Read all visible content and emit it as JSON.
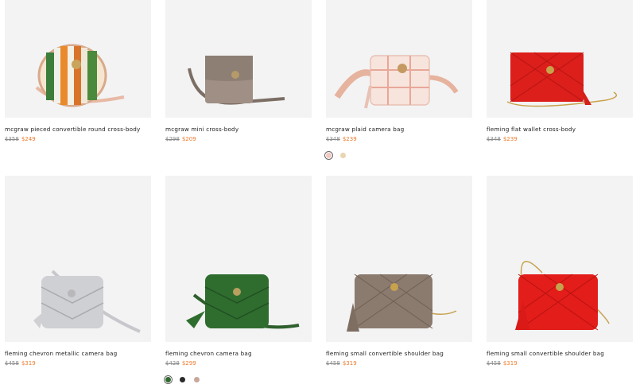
{
  "products": [
    {
      "name": "mcgraw pieced convertible round cross-body",
      "old_price": "$358",
      "sale_price": "$249",
      "image_icon": "round-striped-crossbody-bag-icon"
    },
    {
      "name": "mcgraw mini cross-body",
      "old_price": "$298",
      "sale_price": "$209",
      "image_icon": "taupe-mini-crossbody-bag-icon"
    },
    {
      "name": "mcgraw plaid camera bag",
      "old_price": "$348",
      "sale_price": "$239",
      "image_icon": "plaid-camera-bag-icon",
      "swatches": [
        {
          "color": "#f2c8c0",
          "selected": true
        },
        {
          "color": "#e9d5b0",
          "selected": false
        }
      ]
    },
    {
      "name": "fleming flat wallet cross-body",
      "old_price": "$348",
      "sale_price": "$239",
      "image_icon": "red-quilted-wallet-crossbody-icon"
    },
    {
      "name": "fleming chevron metallic camera bag",
      "old_price": "$458",
      "sale_price": "$319",
      "image_icon": "silver-chevron-camera-bag-icon"
    },
    {
      "name": "fleming chevron camera bag",
      "old_price": "$428",
      "sale_price": "$299",
      "image_icon": "green-chevron-camera-bag-icon",
      "swatches": [
        {
          "color": "#2f6b2e",
          "selected": true
        },
        {
          "color": "#2a2a2a",
          "selected": false
        },
        {
          "color": "#c8a898",
          "selected": false
        }
      ]
    },
    {
      "name": "fleming small convertible shoulder bag",
      "old_price": "$458",
      "sale_price": "$319",
      "image_icon": "taupe-quilted-shoulder-bag-icon"
    },
    {
      "name": "fleming small convertible shoulder bag",
      "old_price": "$458",
      "sale_price": "$319",
      "image_icon": "red-quilted-shoulder-bag-icon"
    }
  ]
}
